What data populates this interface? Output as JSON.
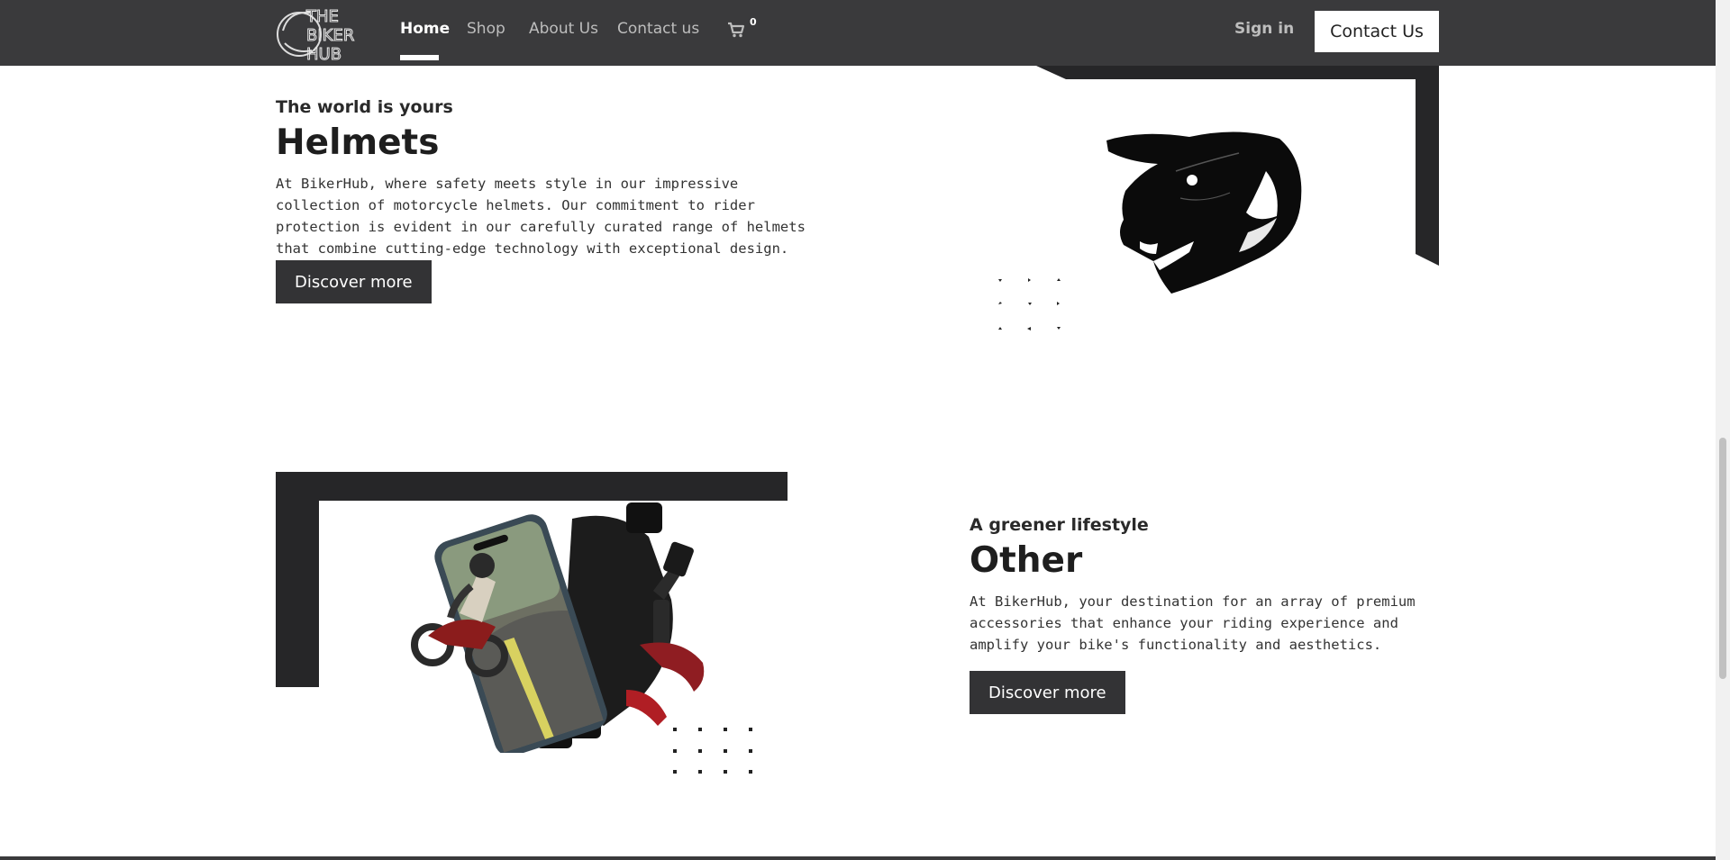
{
  "brand": {
    "logo_lines": [
      "THE",
      "BIKER",
      "HUB"
    ]
  },
  "nav": {
    "links": [
      "Home",
      "Shop",
      "About Us",
      "Contact us"
    ],
    "cart_count": "0",
    "signin": "Sign in",
    "contact_button": "Contact Us"
  },
  "sections": [
    {
      "kicker": "The world is yours",
      "title": "Helmets",
      "lines": [
        "At BikerHub, where safety meets style in our impressive",
        "collection of motorcycle helmets. Our commitment to rider",
        "protection is evident in our carefully curated range of helmets",
        "that combine cutting-edge technology with exceptional design."
      ],
      "button": "Discover more",
      "image_icon": "helmet-icon"
    },
    {
      "kicker": "A greener lifestyle",
      "title": "Other",
      "lines": [
        "At BikerHub, your destination for an array of premium",
        "accessories that enhance your riding experience and",
        "amplify your bike's functionality and aesthetics."
      ],
      "button": "Discover more",
      "image_icon": "phone-mount-icon"
    }
  ],
  "colors": {
    "nav_bg": "#3a3a3c",
    "accent_dark": "#262628",
    "button_bg": "#333335"
  }
}
